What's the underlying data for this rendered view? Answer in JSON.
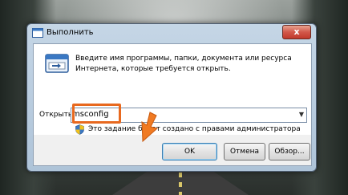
{
  "window": {
    "title": "Выполнить",
    "close_symbol": "x",
    "description": "Введите имя программы, папки, документа или ресурса Интернета, которые требуется открыть.",
    "open_label": "Открыть:",
    "combo_value": "msconfig",
    "combo_arrow": "▼",
    "admin_note": "Это задание будет создано с правами администратора",
    "buttons": {
      "ok": "OK",
      "cancel": "Отмена",
      "browse": "Обзор..."
    }
  },
  "colors": {
    "highlight": "#e8691f",
    "arrow": "#f07a22",
    "accent": "#3c7fb1"
  },
  "icons": [
    "run-app-icon",
    "run-dialog-icon",
    "uac-shield-icon",
    "dropdown-arrow-icon",
    "close-icon",
    "pointer-arrow-icon"
  ]
}
